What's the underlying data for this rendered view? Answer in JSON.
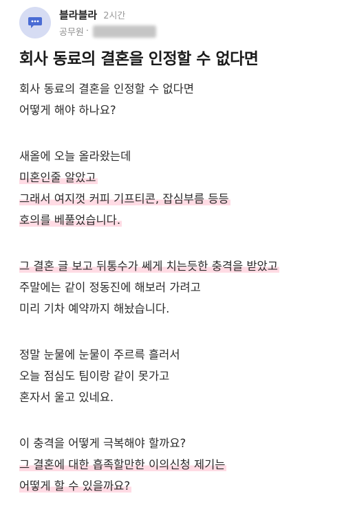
{
  "header": {
    "author": "블라블라",
    "time": "2시간",
    "company": "공무원",
    "separator": "·"
  },
  "post": {
    "title": "회사 동료의 결혼을 인정할 수 없다면",
    "paragraphs": [
      [
        {
          "text": "회사 동료의 결혼을 인정할 수 없다면",
          "highlight": false
        },
        {
          "text": "어떻게 해야 하나요?",
          "highlight": false
        }
      ],
      [
        {
          "text": "새올에 오늘 올라왔는데",
          "highlight": false
        },
        {
          "text": "미혼인줄 알았고",
          "highlight": true
        },
        {
          "text": "그래서 여지껏 커피 기프티콘, 잡심부름 등등",
          "highlight": true
        },
        {
          "text": "호의를 베풀었습니다.",
          "highlight": true
        }
      ],
      [
        {
          "text": "그 결혼 글 보고 뒤통수가 쎄게 치는듯한 충격을 받았고",
          "highlight": true
        },
        {
          "text": "주말에는 같이 정동진에 해보러 가려고",
          "highlight": false
        },
        {
          "text": "미리 기차 예약까지 해놨습니다.",
          "highlight": false
        }
      ],
      [
        {
          "text": "정말 눈물에 눈물이 주르륵 흘러서",
          "highlight": false
        },
        {
          "text": "오늘 점심도 팀이랑 같이 못가고",
          "highlight": false
        },
        {
          "text": "혼자서 울고 있네요.",
          "highlight": false
        }
      ],
      [
        {
          "text": "이 충격을 어떻게 극복해야 할까요?",
          "highlight": false
        },
        {
          "text": "그 결혼에 대한 흡족할만한 이의신청 제기는",
          "highlight": true
        },
        {
          "text": "어떻게 할 수 있을까요?",
          "highlight": true
        }
      ]
    ]
  },
  "colors": {
    "avatar_bg": "#d6dcf3",
    "avatar_icon": "#4a6cd4",
    "highlight": "#ffbecd"
  },
  "icons": {
    "avatar": "chat-bubble-icon"
  }
}
